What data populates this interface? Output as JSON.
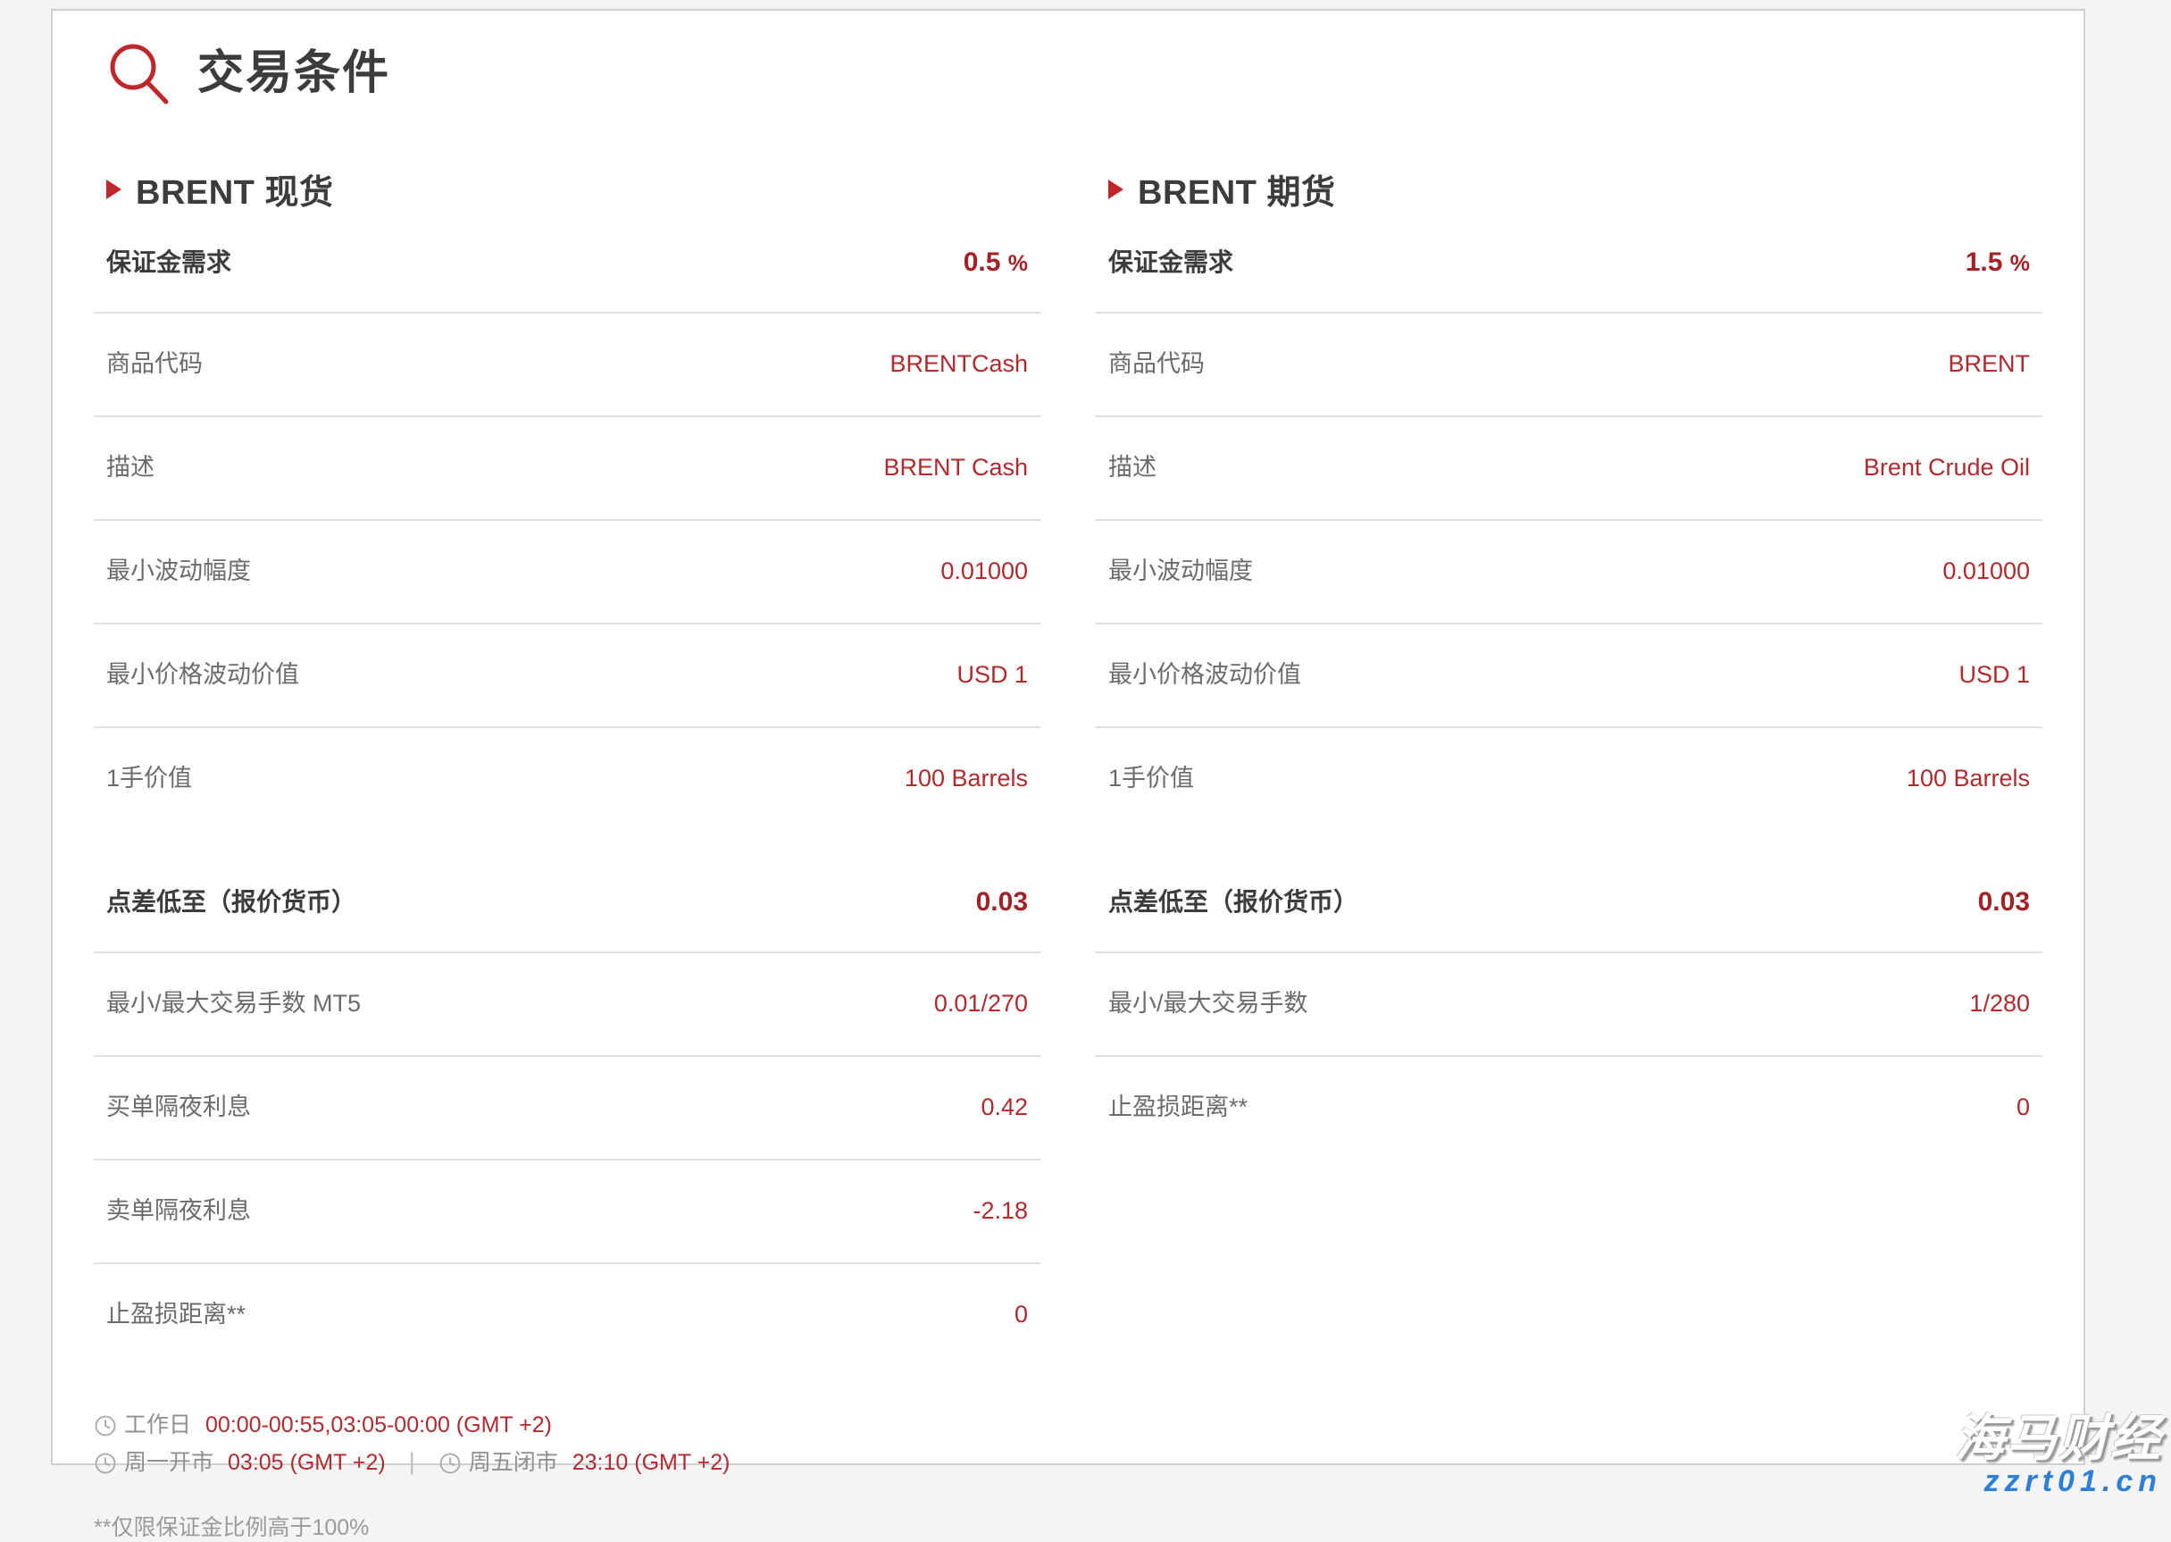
{
  "header": {
    "title": "交易条件",
    "search_icon": "search-icon"
  },
  "columns": [
    {
      "id": "brent-spot",
      "title": "BRENT 现货",
      "bullet_icon": "triangle-right-icon",
      "blocks": [
        {
          "rows": [
            {
              "label": "保证金需求",
              "value": "0.5",
              "unit": "%",
              "emphasis": true
            },
            {
              "label": "商品代码",
              "value": "BRENTCash",
              "unit": "",
              "emphasis": false
            },
            {
              "label": "描述",
              "value": "BRENT Cash",
              "unit": "",
              "emphasis": false
            },
            {
              "label": "最小波动幅度",
              "value": "0.01000",
              "unit": "",
              "emphasis": false
            },
            {
              "label": "最小价格波动价值",
              "value": "USD 1",
              "unit": "",
              "emphasis": false
            },
            {
              "label": "1手价值",
              "value": "100 Barrels",
              "unit": "",
              "emphasis": false
            }
          ]
        },
        {
          "rows": [
            {
              "label": "点差低至（报价货币）",
              "value": "0.03",
              "unit": "",
              "emphasis": true
            },
            {
              "label": "最小/最大交易手数 MT5",
              "value": "0.01/270",
              "unit": "",
              "emphasis": false
            },
            {
              "label": "买单隔夜利息",
              "value": "0.42",
              "unit": "",
              "emphasis": false
            },
            {
              "label": "卖单隔夜利息",
              "value": "-2.18",
              "unit": "",
              "emphasis": false
            },
            {
              "label": "止盈损距离**",
              "value": "0",
              "unit": "",
              "emphasis": false
            }
          ]
        }
      ]
    },
    {
      "id": "brent-futures",
      "title": "BRENT 期货",
      "bullet_icon": "triangle-right-icon",
      "blocks": [
        {
          "rows": [
            {
              "label": "保证金需求",
              "value": "1.5",
              "unit": "%",
              "emphasis": true
            },
            {
              "label": "商品代码",
              "value": "BRENT",
              "unit": "",
              "emphasis": false
            },
            {
              "label": "描述",
              "value": "Brent Crude Oil",
              "unit": "",
              "emphasis": false
            },
            {
              "label": "最小波动幅度",
              "value": "0.01000",
              "unit": "",
              "emphasis": false
            },
            {
              "label": "最小价格波动价值",
              "value": "USD 1",
              "unit": "",
              "emphasis": false
            },
            {
              "label": "1手价值",
              "value": "100 Barrels",
              "unit": "",
              "emphasis": false
            }
          ]
        },
        {
          "rows": [
            {
              "label": "点差低至（报价货币）",
              "value": "0.03",
              "unit": "",
              "emphasis": true
            },
            {
              "label": "最小/最大交易手数",
              "value": "1/280",
              "unit": "",
              "emphasis": false
            },
            {
              "label": "止盈损距离**",
              "value": "0",
              "unit": "",
              "emphasis": false
            }
          ]
        }
      ]
    }
  ],
  "footer": {
    "line1": {
      "icon": "clock-icon",
      "label": "工作日",
      "value": "00:00-00:55,03:05-00:00 (GMT +2)"
    },
    "line2_left": {
      "icon": "clock-icon",
      "label": "周一开市",
      "value": "03:05 (GMT +2)"
    },
    "separator": "|",
    "line2_right": {
      "icon": "clock-icon",
      "label": "周五闭市",
      "value": "23:10 (GMT +2)"
    },
    "footnote": "**仅限保证金比例高于100%"
  },
  "watermark": {
    "main": "海马财经",
    "sub": "zzrt01.cn"
  },
  "colors": {
    "accent_red": "#b02a2f",
    "title_gray": "#3c3c3c",
    "label_gray": "#6b6b6b",
    "rule_gray": "#e2e2e2",
    "page_bg": "#f4f4f4",
    "watermark_blue": "#2f7fd4"
  }
}
